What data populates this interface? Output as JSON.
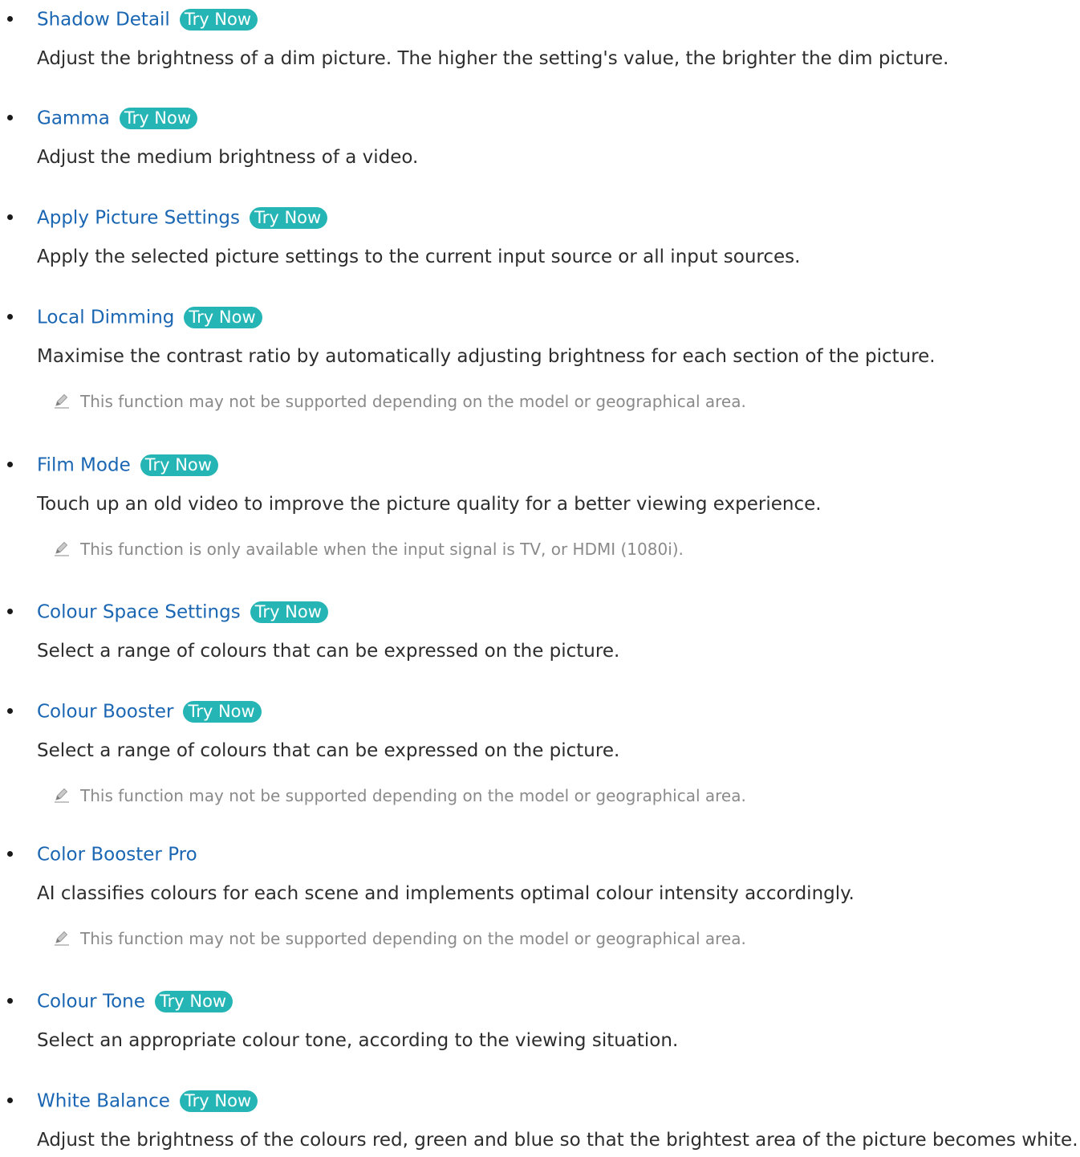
{
  "try_now_label": "Try Now",
  "colors": {
    "title": "#1a66b3",
    "try_now_bg": "#26b5b5",
    "body_text": "#2d2d2d",
    "note_text": "#8a8a8a"
  },
  "items": [
    {
      "title": "Shadow Detail",
      "has_try_now": true,
      "description": "Adjust the brightness of a dim picture. The higher the setting's value, the brighter the dim picture.",
      "note": null
    },
    {
      "title": "Gamma",
      "has_try_now": true,
      "description": "Adjust the medium brightness of a video.",
      "note": null
    },
    {
      "title": "Apply Picture Settings",
      "has_try_now": true,
      "description": "Apply the selected picture settings to the current input source or all input sources.",
      "note": null
    },
    {
      "title": "Local Dimming",
      "has_try_now": true,
      "description": "Maximise the contrast ratio by automatically adjusting brightness for each section of the picture.",
      "note": "This function may not be supported depending on the model or geographical area."
    },
    {
      "title": "Film Mode",
      "has_try_now": true,
      "description": "Touch up an old video to improve the picture quality for a better viewing experience.",
      "note": "This function is only available when the input signal is TV, or HDMI (1080i)."
    },
    {
      "title": "Colour Space Settings",
      "has_try_now": true,
      "description": "Select a range of colours that can be expressed on the picture.",
      "note": null
    },
    {
      "title": "Colour Booster",
      "has_try_now": true,
      "description": "Select a range of colours that can be expressed on the picture.",
      "note": "This function may not be supported depending on the model or geographical area."
    },
    {
      "title": "Color Booster Pro",
      "has_try_now": false,
      "description": "AI classifies colours for each scene and implements optimal colour intensity accordingly.",
      "note": "This function may not be supported depending on the model or geographical area."
    },
    {
      "title": "Colour Tone",
      "has_try_now": true,
      "description": "Select an appropriate colour tone, according to the viewing situation.",
      "note": null
    },
    {
      "title": "White Balance",
      "has_try_now": true,
      "description": "Adjust the brightness of the colours red, green and blue so that the brightest area of the picture becomes white.",
      "note": null
    }
  ]
}
